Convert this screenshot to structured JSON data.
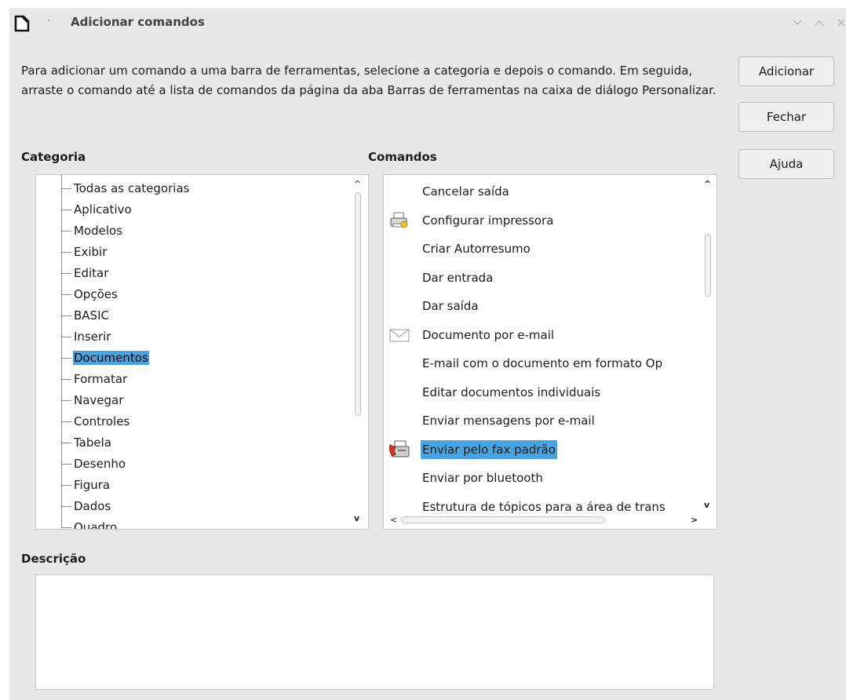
{
  "window": {
    "title": "Adicionar comandos",
    "title_separator": "·"
  },
  "intro_text": "Para adicionar um comando a uma barra de ferramentas, selecione a categoria e depois o comando. Em seguida, arraste o comando até a lista de comandos da página da aba Barras de ferramentas na caixa de diálogo Personalizar.",
  "buttons": {
    "add": "Adicionar",
    "close": "Fechar",
    "help": "Ajuda"
  },
  "labels": {
    "category": "Categoria",
    "commands": "Comandos",
    "description": "Descrição"
  },
  "categories": [
    "Todas as categorias",
    "Aplicativo",
    "Modelos",
    "Exibir",
    "Editar",
    "Opções",
    "BASIC",
    "Inserir",
    "Documentos",
    "Formatar",
    "Navegar",
    "Controles",
    "Tabela",
    "Desenho",
    "Figura",
    "Dados",
    "Quadro"
  ],
  "selected_category": "Documentos",
  "commands": [
    {
      "label": "Cancelar saída",
      "icon": ""
    },
    {
      "label": "Configurar impressora",
      "icon": "printer-setup-icon"
    },
    {
      "label": "Criar Autorresumo",
      "icon": ""
    },
    {
      "label": "Dar entrada",
      "icon": ""
    },
    {
      "label": "Dar saída",
      "icon": ""
    },
    {
      "label": "Documento por e-mail",
      "icon": "mail-icon"
    },
    {
      "label": "E-mail com o documento em formato Op",
      "icon": ""
    },
    {
      "label": "Editar documentos individuais",
      "icon": ""
    },
    {
      "label": "Enviar mensagens por e-mail",
      "icon": ""
    },
    {
      "label": "Enviar pelo fax padrão",
      "icon": "fax-icon"
    },
    {
      "label": "Enviar por bluetooth",
      "icon": ""
    },
    {
      "label": "Estrutura de tópicos para a área de trans",
      "icon": ""
    }
  ],
  "selected_command": "Enviar pelo fax padrão",
  "description_text": "",
  "colors": {
    "selection": "#4aa3de",
    "dialog_bg": "#e8e8e8"
  }
}
